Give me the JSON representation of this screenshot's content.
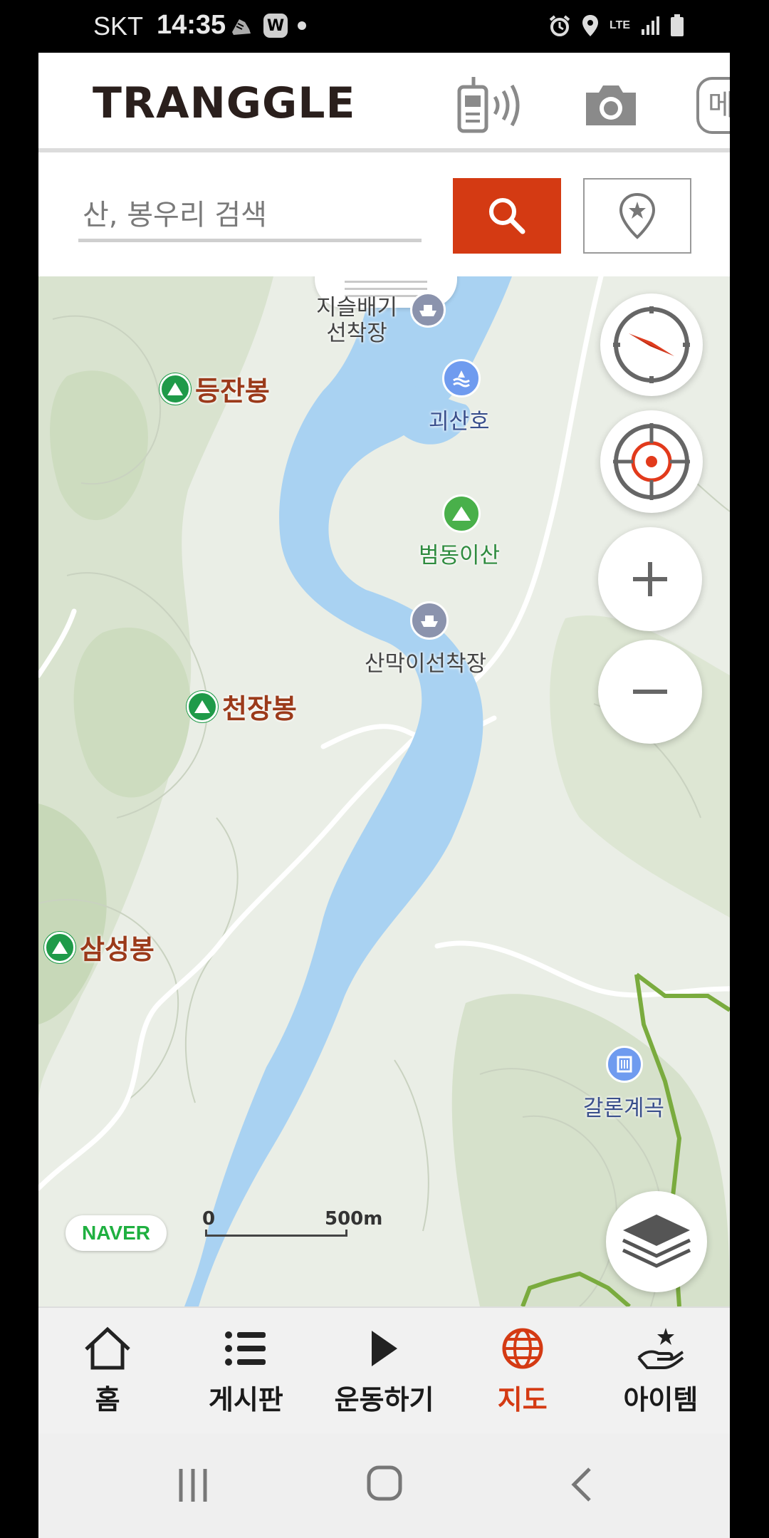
{
  "status_bar": {
    "carrier": "SKT",
    "time": "14:35",
    "net": "LTE"
  },
  "app": {
    "logo": "TRANGGLE",
    "menu_partial": "메",
    "search": {
      "placeholder": "산, 봉우리 검색"
    }
  },
  "map": {
    "peaks": [
      {
        "name": "등잔봉"
      },
      {
        "name": "천장봉"
      },
      {
        "name": "삼성봉"
      }
    ],
    "pois": {
      "ferry_top": "지슬배기\n선착장",
      "lake": "괴산호",
      "mountain": "범동이산",
      "ferry_mid": "산막이선착장",
      "valley": "갈론계곡"
    },
    "attribution": "NAVER",
    "scale": {
      "start": "0",
      "end": "500m"
    }
  },
  "bottom_nav": [
    {
      "label": "홈",
      "icon": "home-icon"
    },
    {
      "label": "게시판",
      "icon": "list-icon"
    },
    {
      "label": "운동하기",
      "icon": "play-icon"
    },
    {
      "label": "지도",
      "icon": "globe-icon",
      "active": true
    },
    {
      "label": "아이템",
      "icon": "item-hand-icon"
    }
  ],
  "colors": {
    "accent": "#d43a13",
    "water": "#a9d2f2",
    "peak_green": "#1f9a49",
    "trail_green": "#7aab3e"
  }
}
